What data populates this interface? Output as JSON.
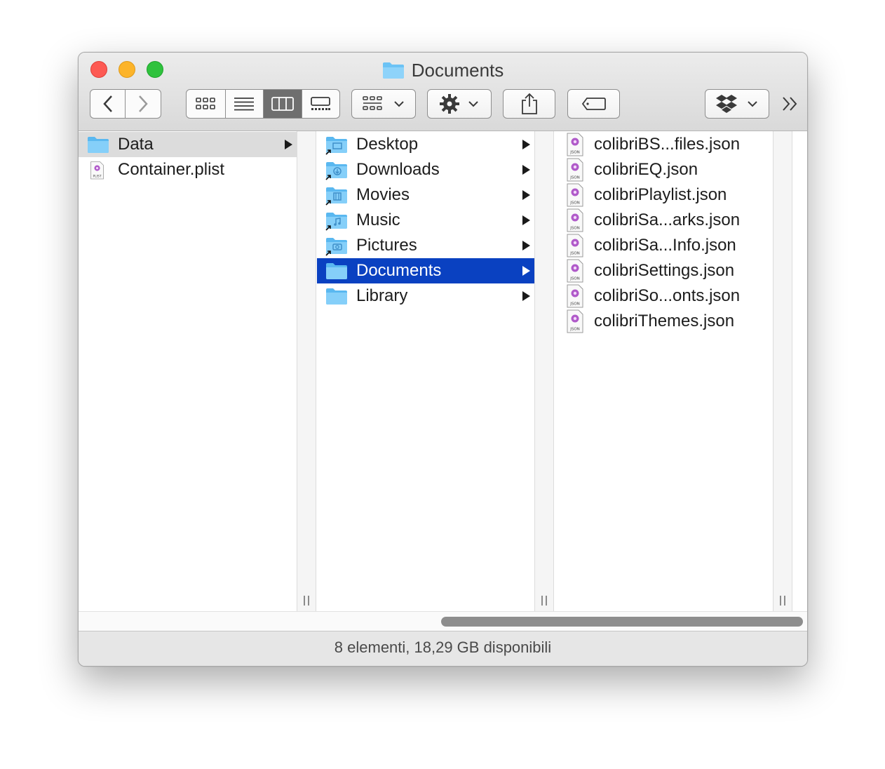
{
  "window": {
    "title": "Documents",
    "status_text": "8 elementi, 18,29 GB disponibili"
  },
  "toolbar": {
    "back_icon": "chevron-left-icon",
    "forward_icon": "chevron-right-icon",
    "view_modes": [
      "icon-view",
      "list-view",
      "column-view",
      "gallery-view"
    ],
    "active_view": "column-view",
    "more_icon": "double-chevron-right-icon"
  },
  "columns": [
    {
      "items": [
        {
          "label": "Data",
          "icon": "folder-icon",
          "state": "dim",
          "has_children": true
        },
        {
          "label": "Container.plist",
          "icon": "plist-file-icon",
          "state": "",
          "has_children": false
        }
      ]
    },
    {
      "items": [
        {
          "label": "Desktop",
          "icon": "folder-alias-icon",
          "state": "",
          "has_children": true
        },
        {
          "label": "Downloads",
          "icon": "folder-alias-icon",
          "state": "",
          "has_children": true
        },
        {
          "label": "Movies",
          "icon": "folder-alias-icon",
          "state": "",
          "has_children": true
        },
        {
          "label": "Music",
          "icon": "folder-alias-icon",
          "state": "",
          "has_children": true
        },
        {
          "label": "Pictures",
          "icon": "folder-alias-icon",
          "state": "",
          "has_children": true
        },
        {
          "label": "Documents",
          "icon": "folder-icon",
          "state": "sel",
          "has_children": true
        },
        {
          "label": "Library",
          "icon": "folder-icon",
          "state": "",
          "has_children": true
        }
      ]
    },
    {
      "items": [
        {
          "label": "colibriBS...files.json",
          "icon": "json-file-icon"
        },
        {
          "label": "colibriEQ.json",
          "icon": "json-file-icon"
        },
        {
          "label": "colibriPlaylist.json",
          "icon": "json-file-icon"
        },
        {
          "label": "colibriSa...arks.json",
          "icon": "json-file-icon"
        },
        {
          "label": "colibriSa...Info.json",
          "icon": "json-file-icon"
        },
        {
          "label": "colibriSettings.json",
          "icon": "json-file-icon"
        },
        {
          "label": "colibriSo...onts.json",
          "icon": "json-file-icon"
        },
        {
          "label": "colibriThemes.json",
          "icon": "json-file-icon"
        }
      ]
    }
  ],
  "colors": {
    "selection": "#0a41c1",
    "folder": "#5ab8f0",
    "close": "#fd5a53",
    "minimize": "#fcb42a",
    "maximize": "#2fc23d"
  }
}
